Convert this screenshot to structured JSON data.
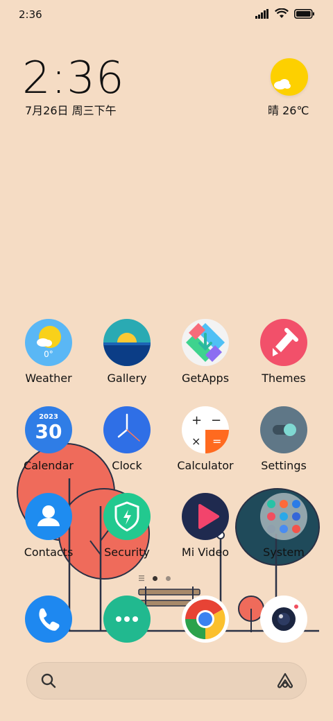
{
  "status": {
    "time": "2:36"
  },
  "clock_widget": {
    "time": "2:36",
    "date": "7月26日 周三下午"
  },
  "weather_widget": {
    "text": "晴 26℃"
  },
  "apps": {
    "weather": {
      "label": "Weather",
      "temp": "0°"
    },
    "gallery": {
      "label": "Gallery"
    },
    "getapps": {
      "label": "GetApps"
    },
    "themes": {
      "label": "Themes"
    },
    "calendar": {
      "label": "Calendar",
      "year": "2023",
      "day": "30"
    },
    "clock": {
      "label": "Clock"
    },
    "calculator": {
      "label": "Calculator"
    },
    "settings": {
      "label": "Settings"
    },
    "contacts": {
      "label": "Contacts"
    },
    "security": {
      "label": "Security"
    },
    "mivideo": {
      "label": "Mi Video"
    },
    "system": {
      "label": "System"
    }
  },
  "dock": [
    "phone",
    "messages",
    "chrome",
    "camera"
  ],
  "pager": {
    "pages": 2,
    "current": 1
  },
  "colors": {
    "background": "#f5dcc4",
    "search_bar": "#ead2bb"
  }
}
